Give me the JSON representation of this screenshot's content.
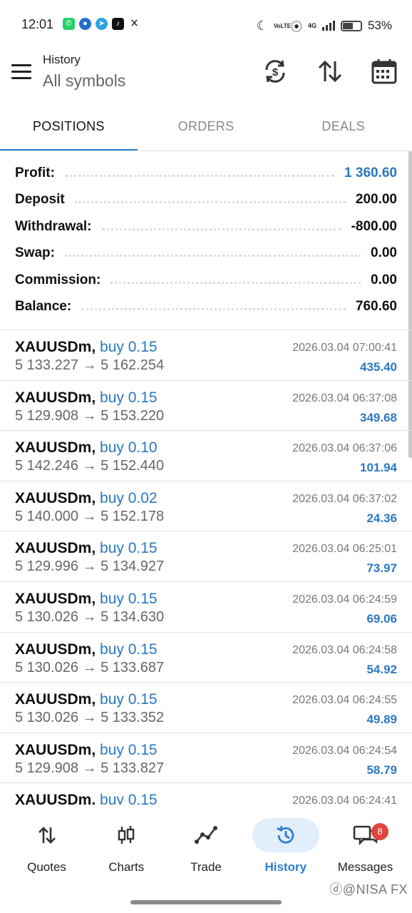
{
  "status_bar": {
    "time": "12:01",
    "network_label": "VoLTE",
    "signal_type": "4G",
    "battery": "53%"
  },
  "app_bar": {
    "title": "History",
    "subtitle": "All symbols"
  },
  "tabs": [
    {
      "label": "POSITIONS",
      "active": true
    },
    {
      "label": "ORDERS",
      "active": false
    },
    {
      "label": "DEALS",
      "active": false
    }
  ],
  "summary": [
    {
      "label": "Profit:",
      "value": "1 360.60",
      "highlight": true
    },
    {
      "label": "Deposit",
      "value": "200.00",
      "highlight": false
    },
    {
      "label": "Withdrawal:",
      "value": "-800.00",
      "highlight": false
    },
    {
      "label": "Swap:",
      "value": "0.00",
      "highlight": false
    },
    {
      "label": "Commission:",
      "value": "0.00",
      "highlight": false
    },
    {
      "label": "Balance:",
      "value": "760.60",
      "highlight": false
    }
  ],
  "deals": [
    {
      "symbol": "XAUUSDm,",
      "side": "buy 0.15",
      "prices": "5 133.227 → 5 162.254",
      "time": "2026.03.04 07:00:41",
      "profit": "435.40"
    },
    {
      "symbol": "XAUUSDm,",
      "side": "buy 0.15",
      "prices": "5 129.908 → 5 153.220",
      "time": "2026.03.04 06:37:08",
      "profit": "349.68"
    },
    {
      "symbol": "XAUUSDm,",
      "side": "buy 0.10",
      "prices": "5 142.246 → 5 152.440",
      "time": "2026.03.04 06:37:06",
      "profit": "101.94"
    },
    {
      "symbol": "XAUUSDm,",
      "side": "buy 0.02",
      "prices": "5 140.000 → 5 152.178",
      "time": "2026.03.04 06:37:02",
      "profit": "24.36"
    },
    {
      "symbol": "XAUUSDm,",
      "side": "buy 0.15",
      "prices": "5 129.996 → 5 134.927",
      "time": "2026.03.04 06:25:01",
      "profit": "73.97"
    },
    {
      "symbol": "XAUUSDm,",
      "side": "buy 0.15",
      "prices": "5 130.026 → 5 134.630",
      "time": "2026.03.04 06:24:59",
      "profit": "69.06"
    },
    {
      "symbol": "XAUUSDm,",
      "side": "buy 0.15",
      "prices": "5 130.026 → 5 133.687",
      "time": "2026.03.04 06:24:58",
      "profit": "54.92"
    },
    {
      "symbol": "XAUUSDm,",
      "side": "buy 0.15",
      "prices": "5 130.026 → 5 133.352",
      "time": "2026.03.04 06:24:55",
      "profit": "49.89"
    },
    {
      "symbol": "XAUUSDm,",
      "side": "buy 0.15",
      "prices": "5 129.908 → 5 133.827",
      "time": "2026.03.04 06:24:54",
      "profit": "58.79"
    },
    {
      "symbol": "XAUUSDm,",
      "side": "buy 0.15",
      "prices": "",
      "time": "2026.03.04 06:24:41",
      "profit": ""
    }
  ],
  "bottom_nav": [
    {
      "label": "Quotes",
      "icon": "quotes-arrows-icon",
      "active": false
    },
    {
      "label": "Charts",
      "icon": "candlestick-icon",
      "active": false
    },
    {
      "label": "Trade",
      "icon": "trade-line-icon",
      "active": false
    },
    {
      "label": "History",
      "icon": "history-clock-icon",
      "active": true
    },
    {
      "label": "Messages",
      "icon": "messages-icon",
      "active": false,
      "badge": "8"
    }
  ],
  "watermark": "@NISA FX",
  "colors": {
    "accent": "#2f7fd0",
    "profit_blue": "#2a78c2",
    "badge_red": "#e0443c"
  }
}
